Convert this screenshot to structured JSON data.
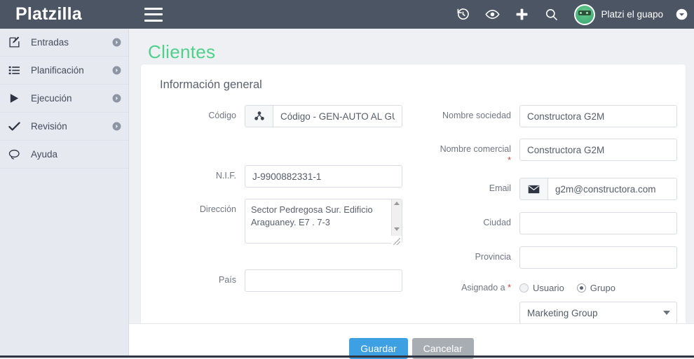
{
  "header": {
    "brand": "Platzilla",
    "menu_icon": "hamburger-icon",
    "icons": [
      {
        "name": "history-icon",
        "label": "Historial"
      },
      {
        "name": "eye-icon",
        "label": "Vista"
      },
      {
        "name": "plus-icon",
        "label": "Nuevo"
      },
      {
        "name": "search-icon",
        "label": "Buscar"
      }
    ],
    "username": "Platzi el guapo",
    "caret_icon": "chevron-down-circle-icon"
  },
  "sidebar": {
    "items": [
      {
        "label": "Entradas",
        "icon": "edit-square-icon",
        "chevron": true
      },
      {
        "label": "Planificación",
        "icon": "list-icon",
        "chevron": true
      },
      {
        "label": "Ejecución",
        "icon": "play-icon",
        "chevron": true
      },
      {
        "label": "Revisión",
        "icon": "check-icon",
        "chevron": true
      },
      {
        "label": "Ayuda",
        "icon": "comment-icon",
        "chevron": false
      }
    ]
  },
  "page": {
    "title": "Clientes",
    "section_title": "Información general"
  },
  "form": {
    "codigo": {
      "label": "Código",
      "addon_icon": "sitemap-icon",
      "value": "Código - GEN-AUTO AL GUARDAR",
      "placeholder": "Código - GEN-AUTO AL GUARDAR"
    },
    "nif": {
      "label": "N.I.F.",
      "value": "J-9900882331-1",
      "placeholder": ""
    },
    "direccion": {
      "label": "Dirección",
      "value": "Sector Pedregosa Sur. Edificio Araguaney. E7 . 7-3",
      "placeholder": ""
    },
    "pais": {
      "label": "País",
      "value": "",
      "placeholder": ""
    },
    "nombre_sociedad": {
      "label": "Nombre sociedad",
      "value": "Constructora G2M",
      "placeholder": ""
    },
    "nombre_comercial": {
      "label": "Nombre comercial",
      "required_mark": "*",
      "value": "Constructora G2M",
      "placeholder": ""
    },
    "email": {
      "label": "Email",
      "addon_icon": "envelope-icon",
      "value": "g2m@constructora.com",
      "placeholder": ""
    },
    "ciudad": {
      "label": "Ciudad",
      "value": "",
      "placeholder": ""
    },
    "provincia": {
      "label": "Provincia",
      "value": "",
      "placeholder": ""
    },
    "asignado": {
      "label": "Asignado a",
      "required_mark": "*",
      "option_user": "Usuario",
      "option_group": "Grupo",
      "selected": "Grupo",
      "group_value": "Marketing Group",
      "group_options": [
        "Marketing Group"
      ]
    }
  },
  "footer": {
    "save_label": "Guardar",
    "cancel_label": "Cancelar"
  },
  "colors": {
    "header_bg": "#4b5563",
    "sidebar_bg": "#e6e9f0",
    "page_bg": "#eef0f4",
    "title_green": "#4fd18b",
    "primary_blue": "#3da0e3",
    "default_gray": "#a8adb3",
    "required_red": "#e23b3b"
  }
}
